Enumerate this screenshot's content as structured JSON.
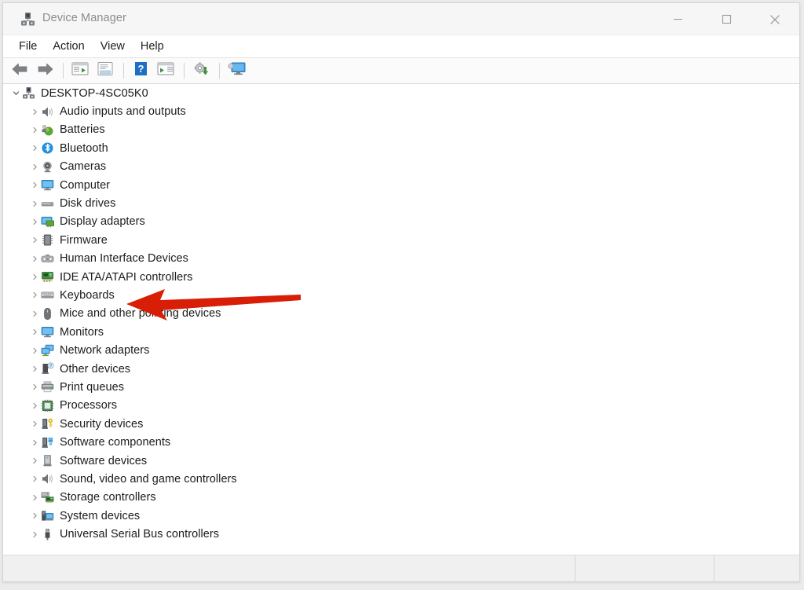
{
  "window": {
    "title": "Device Manager",
    "title_icon": "device-manager-icon",
    "controls": {
      "minimize": "minimize-icon",
      "maximize": "maximize-icon",
      "close": "close-icon"
    }
  },
  "menubar": {
    "items": [
      {
        "label": "File"
      },
      {
        "label": "Action"
      },
      {
        "label": "View"
      },
      {
        "label": "Help"
      }
    ]
  },
  "toolbar": {
    "buttons": [
      {
        "name": "back-icon"
      },
      {
        "name": "forward-icon"
      },
      {
        "name": "show-hide-console-tree-icon"
      },
      {
        "name": "properties-icon"
      },
      {
        "name": "help-icon"
      },
      {
        "name": "scan-for-hardware-changes-icon"
      },
      {
        "name": "update-driver-icon"
      },
      {
        "name": "display-icon"
      }
    ]
  },
  "tree": {
    "root": {
      "label": "DESKTOP-4SC05K0",
      "icon": "computer-root-icon",
      "expanded": true,
      "chevron": "chevron-down-icon"
    },
    "items": [
      {
        "label": "Audio inputs and outputs",
        "icon": "speaker-icon",
        "chevron": "chevron-right-icon"
      },
      {
        "label": "Batteries",
        "icon": "battery-icon",
        "chevron": "chevron-right-icon"
      },
      {
        "label": "Bluetooth",
        "icon": "bluetooth-icon",
        "chevron": "chevron-right-icon"
      },
      {
        "label": "Cameras",
        "icon": "camera-icon",
        "chevron": "chevron-right-icon"
      },
      {
        "label": "Computer",
        "icon": "monitor-icon",
        "chevron": "chevron-right-icon"
      },
      {
        "label": "Disk drives",
        "icon": "disk-drive-icon",
        "chevron": "chevron-right-icon"
      },
      {
        "label": "Display adapters",
        "icon": "display-adapter-icon",
        "chevron": "chevron-right-icon"
      },
      {
        "label": "Firmware",
        "icon": "firmware-icon",
        "chevron": "chevron-right-icon"
      },
      {
        "label": "Human Interface Devices",
        "icon": "hid-icon",
        "chevron": "chevron-right-icon"
      },
      {
        "label": "IDE ATA/ATAPI controllers",
        "icon": "ide-controller-icon",
        "chevron": "chevron-right-icon"
      },
      {
        "label": "Keyboards",
        "icon": "keyboard-icon",
        "chevron": "chevron-right-icon"
      },
      {
        "label": "Mice and other pointing devices",
        "icon": "mouse-icon",
        "chevron": "chevron-right-icon"
      },
      {
        "label": "Monitors",
        "icon": "monitor-icon",
        "chevron": "chevron-right-icon"
      },
      {
        "label": "Network adapters",
        "icon": "network-adapter-icon",
        "chevron": "chevron-right-icon"
      },
      {
        "label": "Other devices",
        "icon": "other-device-icon",
        "chevron": "chevron-right-icon"
      },
      {
        "label": "Print queues",
        "icon": "printer-icon",
        "chevron": "chevron-right-icon"
      },
      {
        "label": "Processors",
        "icon": "processor-icon",
        "chevron": "chevron-right-icon"
      },
      {
        "label": "Security devices",
        "icon": "security-device-icon",
        "chevron": "chevron-right-icon"
      },
      {
        "label": "Software components",
        "icon": "software-component-icon",
        "chevron": "chevron-right-icon"
      },
      {
        "label": "Software devices",
        "icon": "software-device-icon",
        "chevron": "chevron-right-icon"
      },
      {
        "label": "Sound, video and game controllers",
        "icon": "speaker-icon",
        "chevron": "chevron-right-icon"
      },
      {
        "label": "Storage controllers",
        "icon": "storage-controller-icon",
        "chevron": "chevron-right-icon"
      },
      {
        "label": "System devices",
        "icon": "system-device-icon",
        "chevron": "chevron-right-icon"
      },
      {
        "label": "Universal Serial Bus controllers",
        "icon": "usb-icon",
        "chevron": "chevron-right-icon"
      }
    ]
  },
  "statusbar": {
    "panes": [
      "",
      "",
      ""
    ]
  },
  "annotation": {
    "type": "arrow",
    "color": "#D81E06",
    "points_to": "Keyboards"
  },
  "colors": {
    "window_background": "#ffffff",
    "titlebar": "#f6f6f6",
    "toolbar": "#fbfbfb",
    "statusbar": "#f0f0f0",
    "text": "#1b1b1b",
    "title_text": "#8b8b8b",
    "annotation_red": "#D81E06"
  }
}
